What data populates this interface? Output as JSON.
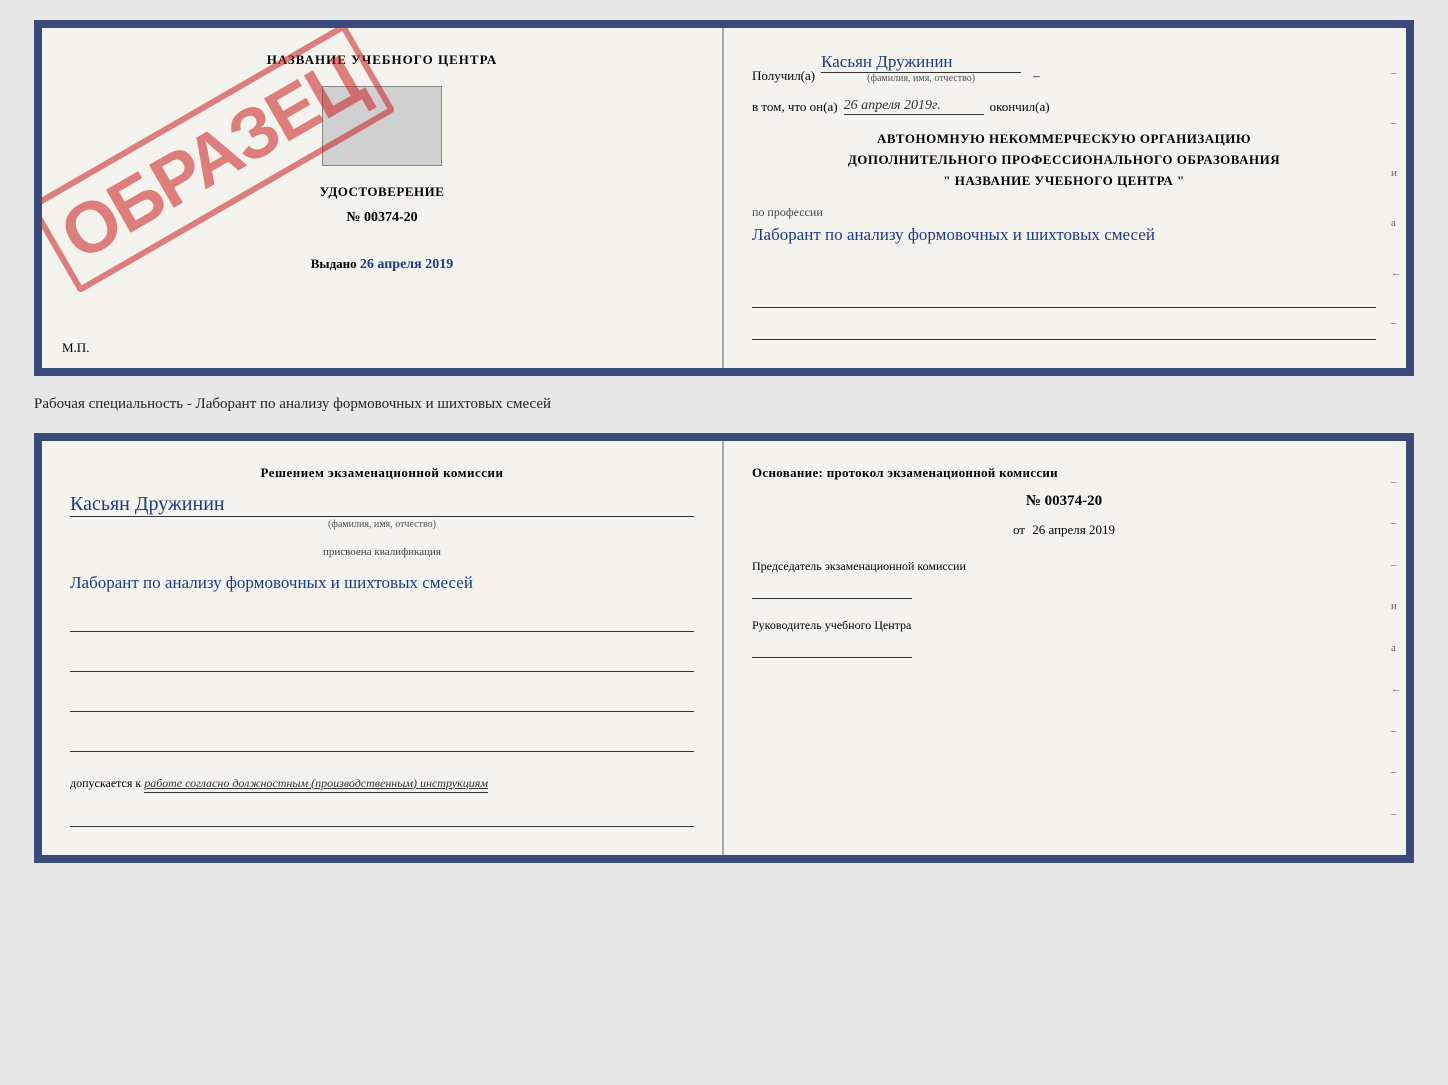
{
  "top_doc": {
    "left": {
      "center_title": "НАЗВАНИЕ УЧЕБНОГО ЦЕНТРА",
      "sample_stamp": "ОБРАЗЕЦ",
      "uds_label": "УДОСТОВЕРЕНИЕ",
      "uds_number": "№ 00374-20",
      "vydano_label": "Выдано",
      "vydano_date": "26 апреля 2019",
      "mp_label": "М.П."
    },
    "right": {
      "poluchil_label": "Получил(а)",
      "poluchil_name": "Касьян Дружинин",
      "fio_small": "(фамилия, имя, отчество)",
      "vtom_prefix": "в том, что он(а)",
      "vtom_date": "26 апреля 2019г.",
      "okonchil": "окончил(а)",
      "avt_line1": "АВТОНОМНУЮ НЕКОММЕРЧЕСКУЮ ОРГАНИЗАЦИЮ",
      "avt_line2": "ДОПОЛНИТЕЛЬНОГО ПРОФЕССИОНАЛЬНОГО ОБРАЗОВАНИЯ",
      "avt_line3": "\"  НАЗВАНИЕ УЧЕБНОГО ЦЕНТРА  \"",
      "po_professii_label": "по профессии",
      "profession_handwritten": "Лаборант по анализу формовочных и шихтовых смесей",
      "right_side_chars": [
        "–",
        "–",
        "и",
        "а",
        "←",
        "–"
      ]
    }
  },
  "specialty_label": "Рабочая специальность - Лаборант по анализу формовочных и шихтовых смесей",
  "bottom_doc": {
    "left": {
      "komissia_title": "Решением  экзаменационной  комиссии",
      "name_handwritten": "Касьян  Дружинин",
      "fio_small": "(фамилия, имя, отчество)",
      "prisv_label": "присвоена квалификация",
      "qual_handwritten": "Лаборант по анализу формовочных и шихтовых смесей",
      "dopuskaetsya_prefix": "допускается к",
      "dopuskaetsya_text": "работе согласно должностным (производственным) инструкциям"
    },
    "right": {
      "osnov_title": "Основание: протокол экзаменационной  комиссии",
      "protocol_number": "№  00374-20",
      "ot_prefix": "от",
      "ot_date": "26 апреля 2019",
      "predsed_label": "Председатель экзаменационной комиссии",
      "ruk_label": "Руководитель учебного Центра",
      "right_side_chars": [
        "–",
        "–",
        "–",
        "и",
        "а",
        "←",
        "–",
        "–",
        "–"
      ]
    }
  }
}
